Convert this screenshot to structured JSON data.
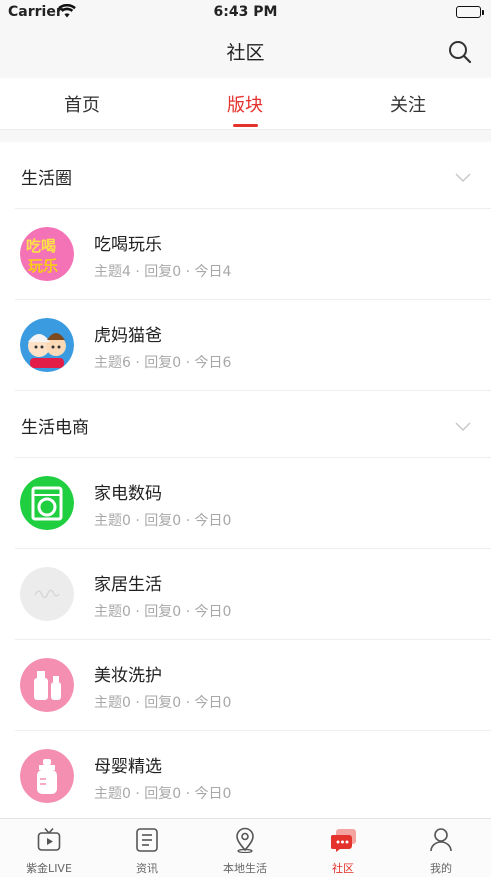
{
  "status_bar": {
    "carrier": "Carrier",
    "time": "6:43 PM"
  },
  "nav": {
    "title": "社区",
    "search_icon": "search-icon"
  },
  "tabs": [
    {
      "label": "首页",
      "active": false
    },
    {
      "label": "版块",
      "active": true
    },
    {
      "label": "关注",
      "active": false
    }
  ],
  "sections": [
    {
      "title": "生活圈",
      "forums": [
        {
          "name": "吃喝玩乐",
          "stats": "主题4 · 回复0 · 今日4"
        },
        {
          "name": "虎妈猫爸",
          "stats": "主题6 · 回复0 · 今日6"
        }
      ]
    },
    {
      "title": "生活电商",
      "forums": [
        {
          "name": "家电数码",
          "stats": "主题0 · 回复0 · 今日0"
        },
        {
          "name": "家居生活",
          "stats": "主题0 · 回复0 · 今日0"
        },
        {
          "name": "美妆洗护",
          "stats": "主题0 · 回复0 · 今日0"
        },
        {
          "name": "母婴精选",
          "stats": "主题0 · 回复0 · 今日0"
        }
      ]
    }
  ],
  "tab_bar": [
    {
      "label": "紫金LIVE",
      "icon": "tv-icon",
      "active": false
    },
    {
      "label": "资讯",
      "icon": "news-icon",
      "active": false
    },
    {
      "label": "本地生活",
      "icon": "location-icon",
      "active": false
    },
    {
      "label": "社区",
      "icon": "chat-icon",
      "active": true
    },
    {
      "label": "我的",
      "icon": "profile-icon",
      "active": false
    }
  ],
  "colors": {
    "accent": "#e4322c",
    "muted_text": "#a8a8a8",
    "background": "#f7f7f7"
  }
}
